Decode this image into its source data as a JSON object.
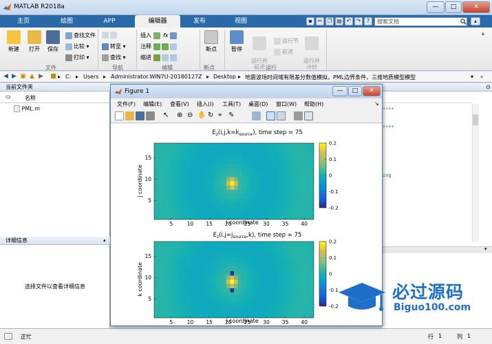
{
  "window": {
    "title": "MATLAB R2018a"
  },
  "tabs": [
    {
      "label": "主页",
      "active": false
    },
    {
      "label": "绘图",
      "active": false
    },
    {
      "label": "APP",
      "active": false
    },
    {
      "label": "编辑器",
      "active": true
    },
    {
      "label": "发布",
      "active": false
    },
    {
      "label": "视图",
      "active": false
    }
  ],
  "search": {
    "placeholder": "搜索文档"
  },
  "ribbon": {
    "file": {
      "group": "文件",
      "new": "新建",
      "open": "打开",
      "save": "保存",
      "find_files": "查找文件",
      "compare": "比较",
      "print": "打印"
    },
    "nav": {
      "group": "导航",
      "goto": "转至",
      "find": "查找"
    },
    "edit": {
      "group": "编辑",
      "insert": "插入",
      "fx": "fx",
      "comment": "注释",
      "indent": "缩进"
    },
    "breakpoints": {
      "group": "断点",
      "label": "断点"
    },
    "run": {
      "group": "运行",
      "pause": "暂停",
      "run_advance": "运行并\n前进",
      "run_section": "运行节",
      "advance": "前进",
      "run_time": "运行并\n计时"
    }
  },
  "path": {
    "parts": [
      "C:",
      "Users",
      "Administrator.WIN7U-20180127Z",
      "Desktop",
      "地震波场时间域有限差分数值模拟，PML边界条件，三维地质模型模型"
    ]
  },
  "current_folder": {
    "title": "当前文件夹",
    "name_col": "名称",
    "files": [
      "PML.m"
    ]
  },
  "details": {
    "title": "详细信息",
    "hint": "选择文件以查看详细信息"
  },
  "status": {
    "text": "正忙",
    "row_label": "行",
    "row": "1",
    "col_label": "列",
    "col": "1"
  },
  "editor": {
    "fragments": [
      "****",
      "****",
      "ing"
    ]
  },
  "figure": {
    "title": "Figure 1",
    "menus": [
      "文件(F)",
      "编辑(E)",
      "查看(V)",
      "插入(I)",
      "工具(T)",
      "桌面(D)",
      "窗口(W)",
      "帮助(H)"
    ]
  },
  "watermark": {
    "cn": "必过源码",
    "en": "Biguo100.com"
  },
  "colors": {
    "ribbon_blue": "#2b6aa8",
    "accent": "#1e6fc7"
  },
  "chart_data": [
    {
      "type": "heatmap",
      "title": "E_z(i,j,k=k_source), time step = 75",
      "xlabel": "i coordinate",
      "ylabel": "j coordinate",
      "xlim": [
        0.5,
        42.5
      ],
      "ylim": [
        0.5,
        18.5
      ],
      "xticks": [
        5,
        10,
        15,
        20,
        25,
        30,
        35,
        40
      ],
      "yticks": [
        5,
        10,
        15
      ],
      "grid_size": [
        42,
        18
      ],
      "source": {
        "i": 21,
        "j": 9
      },
      "colorbar": {
        "min": -0.2,
        "max": 0.2,
        "ticks": [
          -0.2,
          -0.1,
          0,
          0.1,
          0.2
        ]
      }
    },
    {
      "type": "heatmap",
      "title": "E_z(i,j=j_source,k), time step = 75",
      "xlabel": "i coordinate",
      "ylabel": "k coordinate",
      "xlim": [
        0.5,
        42.5
      ],
      "ylim": [
        0.5,
        18.5
      ],
      "xticks": [
        5,
        10,
        15,
        20,
        25,
        30,
        35,
        40
      ],
      "yticks": [
        5,
        10,
        15
      ],
      "grid_size": [
        42,
        18
      ],
      "source": {
        "i": 21,
        "k": 9
      },
      "colorbar": {
        "min": -0.2,
        "max": 0.2,
        "ticks": [
          -0.2,
          -0.1,
          0,
          0.1,
          0.2
        ]
      }
    }
  ]
}
